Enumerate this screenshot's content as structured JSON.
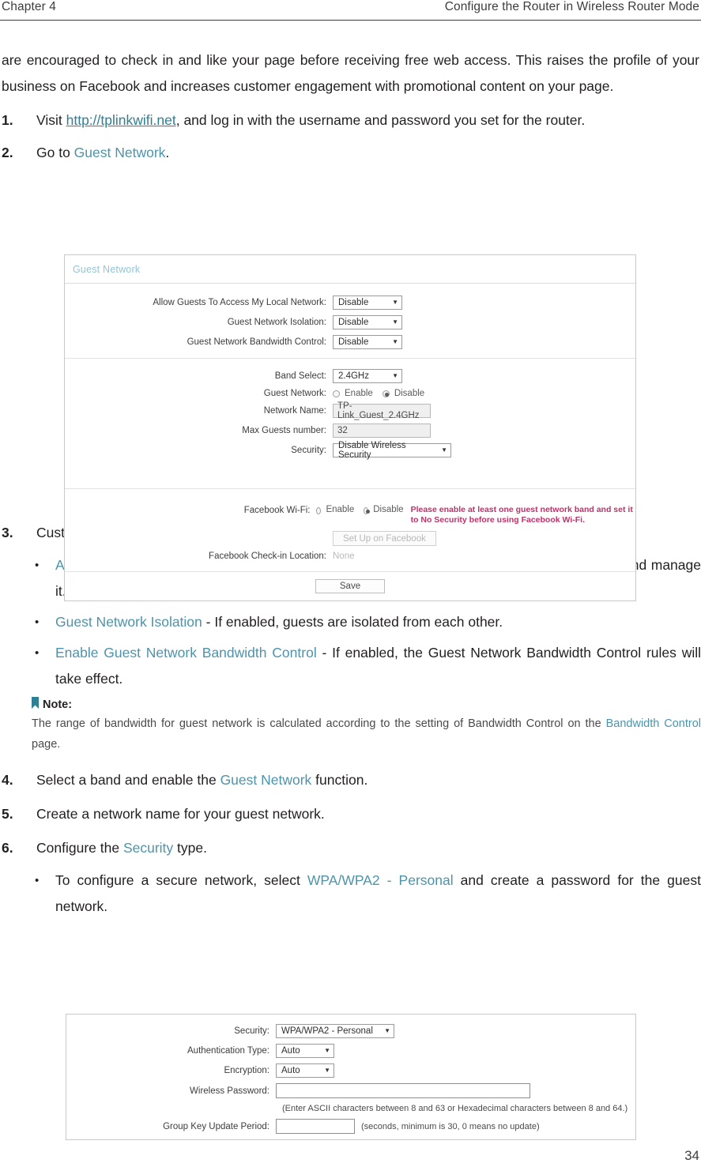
{
  "header": {
    "chapter": "Chapter 4",
    "title": "Configure the Router in Wireless Router Mode"
  },
  "intro": {
    "text": "are encouraged to check in and like your page before receiving free web access. This raises the profile of your business on Facebook and increases customer engagement with promotional content on your page."
  },
  "steps": [
    {
      "num": "1.",
      "pre": "Visit ",
      "link": "http://tplinkwifi.net",
      "post": ", and log in with the username and password you set for the router."
    },
    {
      "num": "2.",
      "pre": "Go to ",
      "link": "Guest Network",
      "post": "."
    },
    {
      "num": "3.",
      "pre": "Customize guest network permissions.",
      "link": "",
      "post": ""
    },
    {
      "num": "4.",
      "pre": "Select a band and enable the ",
      "link": "Guest Network",
      "post": " function."
    },
    {
      "num": "5.",
      "pre": "Create a network name for your guest network.",
      "link": "",
      "post": ""
    },
    {
      "num": "6.",
      "pre": "Configure the ",
      "link": "Security",
      "post": " type."
    }
  ],
  "bullets": [
    {
      "marker": "•",
      "link": "Allow Guest To Access My Local Network",
      "rest": " - If enabled, guests can access the local network and manage it."
    },
    {
      "marker": "•",
      "link": "Guest Network Isolation",
      "rest": " - If enabled, guests are isolated from each other."
    },
    {
      "marker": "•",
      "link": "Enable Guest Network Bandwidth Control",
      "rest": " - If enabled, the Guest Network Bandwidth Control rules will take effect."
    }
  ],
  "bullet_security": {
    "marker": "•",
    "pre": "To configure a secure network, select ",
    "link": "WPA/WPA2 - Personal",
    "post": " and create a password for the guest network."
  },
  "note": {
    "icon": "bookmark-ribbon-icon",
    "label": "Note:",
    "pre": "The range of bandwidth for guest network is calculated according to the setting of Bandwidth Control on the ",
    "link": "Bandwidth Control",
    "post": " page."
  },
  "guest_panel": {
    "title": "Guest Network",
    "section_access": {
      "rows": [
        {
          "label": "Allow Guests To Access My Local Network:",
          "value": "Disable"
        },
        {
          "label": "Guest Network Isolation:",
          "value": "Disable"
        },
        {
          "label": "Guest Network Bandwidth Control:",
          "value": "Disable"
        }
      ]
    },
    "section_band": {
      "band_label": "Band Select:",
      "band_value": "2.4GHz",
      "guest_label": "Guest Network:",
      "radio_enable": "Enable",
      "radio_disable": "Disable",
      "guest_selected": "Disable",
      "name_label": "Network Name:",
      "name_value": "TP-Link_Guest_2.4GHz",
      "max_label": "Max Guests number:",
      "max_value": "32",
      "security_label": "Security:",
      "security_value": "Disable Wireless Security"
    },
    "section_facebook": {
      "fb_label": "Facebook Wi-Fi:",
      "radio_enable": "Enable",
      "radio_disable": "Disable",
      "fb_selected": "Disable",
      "warning": "Please enable at least one guest network band and set it to No Security before using Facebook Wi-Fi.",
      "setup_button": "Set Up on Facebook",
      "checkin_label": "Facebook Check-in Location:",
      "checkin_value": "None"
    },
    "save_button": "Save"
  },
  "security_panel": {
    "rows": {
      "security_label": "Security:",
      "security_value": "WPA/WPA2 - Personal",
      "auth_label": "Authentication Type:",
      "auth_value": "Auto",
      "enc_label": "Encryption:",
      "enc_value": "Auto",
      "pw_label": "Wireless Password:",
      "pw_value": "",
      "pw_hint": "(Enter ASCII characters between 8 and 63 or Hexadecimal characters between 8 and 64.)",
      "gk_label": "Group Key Update Period:",
      "gk_value": "",
      "gk_hint": "(seconds, minimum is 30, 0 means no update)"
    }
  },
  "folio": "34",
  "colors": {
    "link": "#2e7f94",
    "highlight": "#4d94aa",
    "panel_title": "#8fc6d8",
    "warning": "#c0306a",
    "note_ribbon": "#2e8095"
  }
}
